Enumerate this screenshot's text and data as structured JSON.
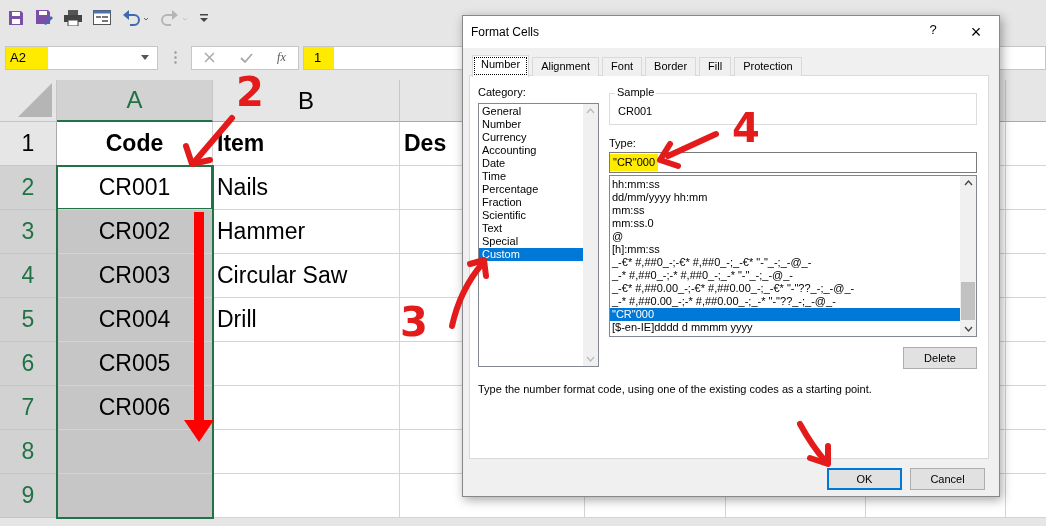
{
  "quick_access_toolbar": [
    {
      "kind": "save",
      "disabled": false
    },
    {
      "kind": "save-as",
      "disabled": false
    },
    {
      "kind": "print",
      "disabled": false
    },
    {
      "kind": "form",
      "disabled": false
    },
    {
      "kind": "undo",
      "disabled": false
    },
    {
      "kind": "redo",
      "disabled": true
    },
    {
      "kind": "customize",
      "disabled": false
    }
  ],
  "name_box": {
    "value": "A2",
    "highlighted": true
  },
  "formula_bar": {
    "function_label": "fx",
    "value": "1",
    "highlighted": true
  },
  "sheet": {
    "columns": [
      {
        "label": "A",
        "selected": true
      },
      {
        "label": "B",
        "selected": false
      }
    ],
    "rows": [
      {
        "number": "1",
        "selected": false,
        "active": false,
        "cells": [
          "Code",
          "Item",
          "Des"
        ]
      },
      {
        "number": "2",
        "selected": true,
        "active": true,
        "cells": [
          "CR001",
          "Nails"
        ]
      },
      {
        "number": "3",
        "selected": true,
        "active": false,
        "cells": [
          "CR002",
          "Hammer"
        ]
      },
      {
        "number": "4",
        "selected": true,
        "active": false,
        "cells": [
          "CR003",
          "Circular Saw"
        ]
      },
      {
        "number": "5",
        "selected": true,
        "active": false,
        "cells": [
          "CR004",
          "Drill"
        ]
      },
      {
        "number": "6",
        "selected": true,
        "active": false,
        "cells": [
          "CR005"
        ]
      },
      {
        "number": "7",
        "selected": true,
        "active": false,
        "cells": [
          "CR006"
        ]
      },
      {
        "number": "8",
        "selected": true,
        "active": false,
        "cells": []
      },
      {
        "number": "9",
        "selected": true,
        "active": false,
        "cells": []
      }
    ]
  },
  "dialog": {
    "title": "Format Cells",
    "help": "?",
    "close": "×",
    "tabs": [
      {
        "label": "Number",
        "selected": true
      },
      {
        "label": "Alignment",
        "selected": false
      },
      {
        "label": "Font",
        "selected": false
      },
      {
        "label": "Border",
        "selected": false
      },
      {
        "label": "Fill",
        "selected": false
      },
      {
        "label": "Protection",
        "selected": false
      }
    ],
    "category_label": "Category:",
    "categories": [
      {
        "label": "General",
        "selected": false
      },
      {
        "label": "Number",
        "selected": false
      },
      {
        "label": "Currency",
        "selected": false
      },
      {
        "label": "Accounting",
        "selected": false
      },
      {
        "label": "Date",
        "selected": false
      },
      {
        "label": "Time",
        "selected": false
      },
      {
        "label": "Percentage",
        "selected": false
      },
      {
        "label": "Fraction",
        "selected": false
      },
      {
        "label": "Scientific",
        "selected": false
      },
      {
        "label": "Text",
        "selected": false
      },
      {
        "label": "Special",
        "selected": false
      },
      {
        "label": "Custom",
        "selected": true
      }
    ],
    "sample_label": "Sample",
    "sample_value": "CR001",
    "type_label": "Type:",
    "type_value": "\"CR\"000",
    "type_highlighted": true,
    "formats": [
      {
        "label": "hh:mm:ss",
        "selected": false
      },
      {
        "label": "dd/mm/yyyy hh:mm",
        "selected": false
      },
      {
        "label": "mm:ss",
        "selected": false
      },
      {
        "label": "mm:ss.0",
        "selected": false
      },
      {
        "label": "@",
        "selected": false
      },
      {
        "label": "[h]:mm:ss",
        "selected": false
      },
      {
        "label": "_-€* #,##0_-;-€* #,##0_-;_-€* \"-\"_-;_-@_-",
        "selected": false
      },
      {
        "label": "_-* #,##0_-;-* #,##0_-;_-* \"-\"_-;_-@_-",
        "selected": false
      },
      {
        "label": "_-€* #,##0.00_-;-€* #,##0.00_-;_-€* \"-\"??_-;_-@_-",
        "selected": false
      },
      {
        "label": "_-* #,##0.00_-;-* #,##0.00_-;_-* \"-\"??_-;_-@_-",
        "selected": false
      },
      {
        "label": "\"CR\"000",
        "selected": true
      },
      {
        "label": "[$-en-IE]dddd d mmmm yyyy",
        "selected": false
      }
    ],
    "delete_button": "Delete",
    "hint": "Type the number format code, using one of the existing codes as a starting point.",
    "buttons": [
      {
        "label": "OK",
        "default": true
      },
      {
        "label": "Cancel",
        "default": false
      }
    ]
  },
  "annotations": [
    {
      "label": "2"
    },
    {
      "label": "3"
    },
    {
      "label": "4"
    }
  ]
}
